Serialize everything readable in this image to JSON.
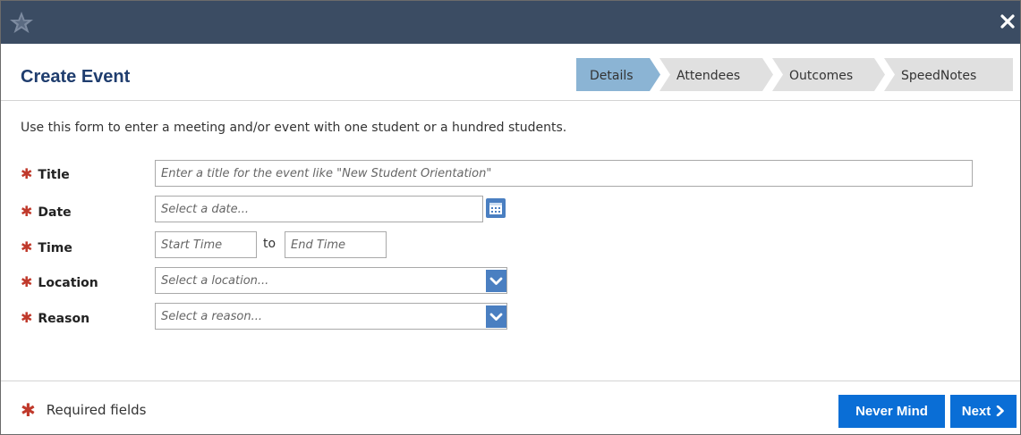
{
  "header": {
    "title": "Create Event"
  },
  "steps": [
    {
      "label": "Details",
      "active": true
    },
    {
      "label": "Attendees",
      "active": false
    },
    {
      "label": "Outcomes",
      "active": false
    },
    {
      "label": "SpeedNotes",
      "active": false
    }
  ],
  "intro": "Use this form to enter a meeting and/or event with one student or a hundred students.",
  "form": {
    "title": {
      "label": "Title",
      "placeholder": "Enter a title for the event like \"New Student Orientation\""
    },
    "date": {
      "label": "Date",
      "placeholder": "Select a date..."
    },
    "time": {
      "label": "Time",
      "start_placeholder": "Start Time",
      "separator": "to",
      "end_placeholder": "End Time"
    },
    "location": {
      "label": "Location",
      "placeholder": "Select a location..."
    },
    "reason": {
      "label": "Reason",
      "placeholder": "Select a reason..."
    }
  },
  "footer": {
    "required_note": "Required fields",
    "required_marker": "✱",
    "never_mind_label": "Never Mind",
    "next_label": "Next"
  },
  "colors": {
    "titlebar": "#3b4c63",
    "accent": "#0a6ed6",
    "active_step": "#8bb4d4",
    "inactive_step": "#e0e0e0",
    "required": "#c0392b",
    "title_text": "#1f3d6e"
  },
  "icons": {
    "logo": "star-logo-icon",
    "close": "close-icon",
    "calendar": "calendar-icon",
    "dropdown": "chevron-down-icon",
    "next": "chevron-right-icon"
  }
}
